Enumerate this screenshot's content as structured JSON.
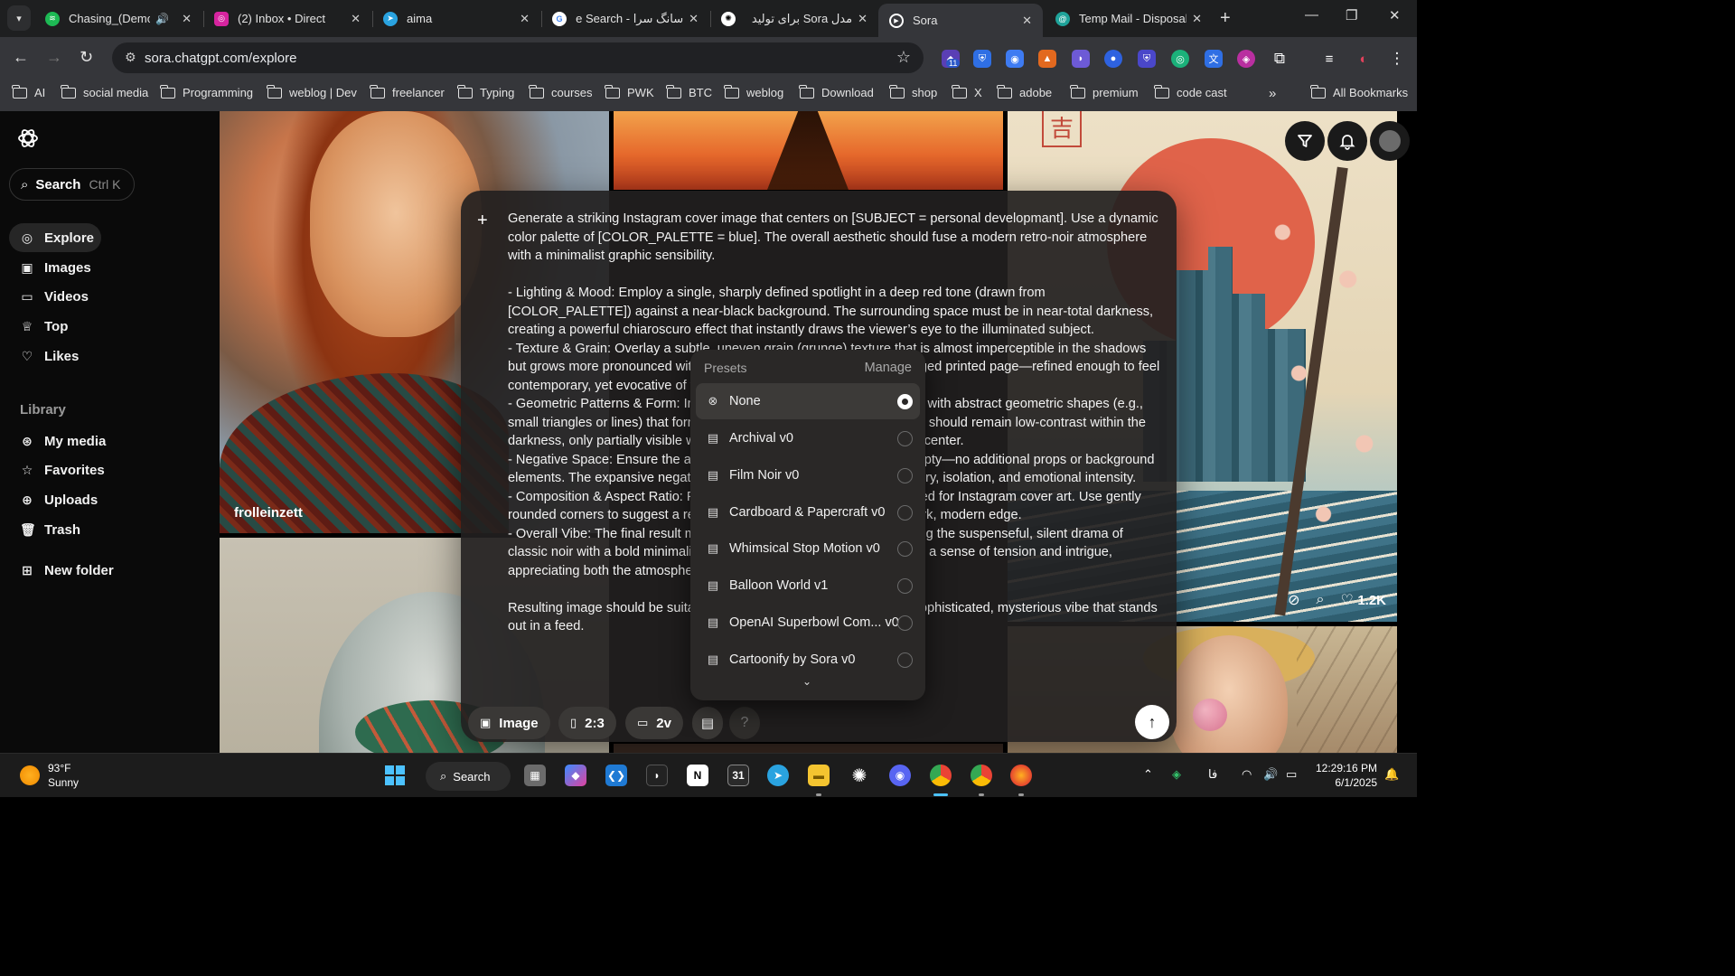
{
  "browser": {
    "tabs": [
      {
        "title": "Chasing_(Demo)",
        "icon": "spotify-icon",
        "color": "#1db954"
      },
      {
        "title": "(2) Inbox • Direct",
        "icon": "instagram-icon",
        "color": "#d6249f"
      },
      {
        "title": "aima",
        "icon": "telegram-icon",
        "color": "#2aa3e0"
      },
      {
        "title": "سانگ سرا - Google Search",
        "icon": "google-icon",
        "color": "#ffffff"
      },
      {
        "title": "مدل Sora برای تولید",
        "icon": "openai-icon",
        "color": "#ffffff"
      },
      {
        "title": "Sora",
        "icon": "sora-icon",
        "color": "#ffffff",
        "active": true
      },
      {
        "title": "Temp Mail - Disposable",
        "icon": "tempmail-icon",
        "color": "#1fa39a"
      }
    ],
    "url": "sora.chatgpt.com/explore",
    "extension_badge": "11",
    "bookmarks": [
      "AI",
      "social media",
      "Programming",
      "weblog | Dev",
      "freelancer",
      "Typing",
      "courses",
      "PWK",
      "BTC",
      "weblog",
      "Download",
      "shop",
      "X",
      "adobe",
      "premium",
      "code cast"
    ],
    "all_bookmarks": "All Bookmarks"
  },
  "sidebar": {
    "search_label": "Search",
    "search_shortcut": "Ctrl K",
    "nav": [
      {
        "label": "Explore",
        "icon": "compass-icon",
        "active": true
      },
      {
        "label": "Images",
        "icon": "image-icon"
      },
      {
        "label": "Videos",
        "icon": "video-icon"
      },
      {
        "label": "Top",
        "icon": "trophy-icon"
      },
      {
        "label": "Likes",
        "icon": "heart-icon"
      }
    ],
    "library_heading": "Library",
    "library": [
      {
        "label": "My media",
        "icon": "media-icon"
      },
      {
        "label": "Favorites",
        "icon": "star-icon"
      },
      {
        "label": "Uploads",
        "icon": "upload-icon"
      },
      {
        "label": "Trash",
        "icon": "trash-icon"
      }
    ],
    "new_folder": "New folder"
  },
  "gallery": {
    "tile1_author": "frolleinzett",
    "tile3_likes": "1.2K"
  },
  "composer": {
    "prompt": "Generate a striking Instagram cover image that centers on [SUBJECT = personal developmant]. Use a dynamic color palette of [COLOR_PALETTE = blue]. The overall aesthetic should fuse a modern retro-noir atmosphere with a minimalist graphic sensibility.\n\n- Lighting & Mood: Employ a single, sharply defined spotlight in a deep red tone (drawn from [COLOR_PALETTE]) against a near-black background. The surrounding space must be in near-total darkness, creating a powerful chiaroscuro effect that instantly draws the viewer’s eye to the illuminated subject.\n- Texture & Grain: Overlay a subtle, uneven grain (grunge) texture that is almost imperceptible in the shadows but grows more pronounced within the spotlight, giving the look of an aged printed page—refined enough to feel contemporary, yet evocative of vintage print.\n- Geometric Patterns & Form: Integrate, just outside the spotlight’s area with abstract geometric shapes (e.g., small triangles or lines) that form the subject’s silhouette. These shapes should remain low-contrast within the darkness, only partially visible when the eye focuses on the illuminated center.\n- Negative Space: Ensure the area around the subject is completely empty—no additional props or background elements. The expansive negative space heightens the feeling of mystery, isolation, and emotional intensity.\n- Composition & Aspect Ratio: Format the image for a 2:3 ratio, optimized for Instagram cover art. Use gently rounded corners to suggest a retro frame without compromising the stark, modern edge.\n- Overall Vibe: The final result must feel cinematic and graphic—blending the suspenseful, silent drama of classic noir with a bold minimalist approach. Viewers should experience a sense of tension and intrigue, appreciating both the atmosphere and the pattern-driven form.\n\nResulting image should be suitable as an Instagram cover, evoking a sophisticated, mysterious vibe that stands out in a feed.",
    "type_label": "Image",
    "aspect_label": "2:3",
    "variations_label": "2v",
    "help_label": "?"
  },
  "presets": {
    "heading": "Presets",
    "manage": "Manage",
    "items": [
      {
        "label": "None",
        "selected": true
      },
      {
        "label": "Archival v0"
      },
      {
        "label": "Film Noir v0"
      },
      {
        "label": "Cardboard & Papercraft v0"
      },
      {
        "label": "Whimsical Stop Motion v0"
      },
      {
        "label": "Balloon World v1"
      },
      {
        "label": "OpenAI Superbowl Com... v0"
      },
      {
        "label": "Cartoonify by Sora v0"
      }
    ]
  },
  "taskbar": {
    "temperature": "93°F",
    "condition": "Sunny",
    "search_label": "Search",
    "language": "فا",
    "time": "12:29:16 PM",
    "date": "6/1/2025"
  }
}
